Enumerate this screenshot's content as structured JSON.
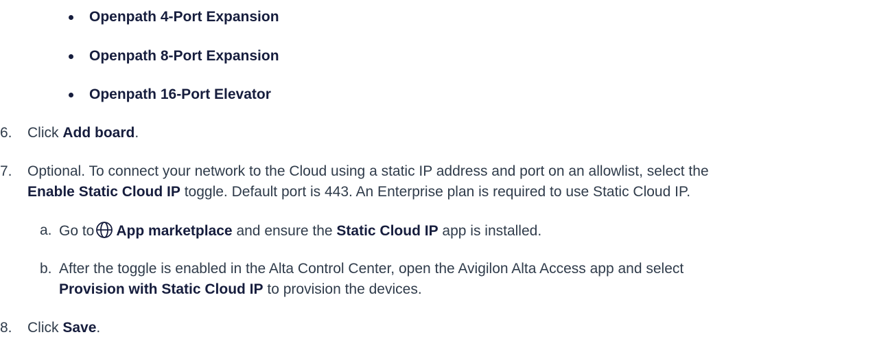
{
  "bullets": [
    "Openpath 4-Port Expansion",
    "Openpath 8-Port Expansion",
    "Openpath 16-Port Elevator"
  ],
  "step6": {
    "number": "6.",
    "prefix": "Click ",
    "bold": "Add board",
    "suffix": "."
  },
  "step7": {
    "number": "7.",
    "line1": "Optional. To connect your network to the Cloud using a static IP address and port on an allowlist, select the",
    "line2_bold": "Enable Static Cloud IP",
    "line2_rest": " toggle. Default port is 443. An Enterprise plan is required to use Static Cloud IP."
  },
  "sub_a": {
    "letter": "a.",
    "prefix": "Go to",
    "icon": "globe-icon",
    "bold1": "App marketplace",
    "middle": " and ensure the ",
    "bold2": "Static Cloud IP",
    "suffix": " app is installed."
  },
  "sub_b": {
    "letter": "b.",
    "line1": "After the toggle is enabled in the Alta Control Center, open the Avigilon Alta Access app and select",
    "line2_bold": "Provision with Static Cloud IP",
    "line2_rest": " to provision the devices."
  },
  "step8": {
    "number": "8.",
    "prefix": "Click ",
    "bold": "Save",
    "suffix": "."
  },
  "colors": {
    "text": "#2f3b4a",
    "bold_text": "#161d3d"
  }
}
